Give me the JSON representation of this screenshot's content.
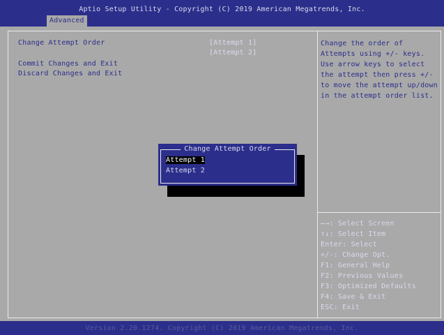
{
  "header": {
    "title": "Aptio Setup Utility - Copyright (C) 2019 American Megatrends, Inc.",
    "active_tab": "Advanced"
  },
  "main": {
    "items": [
      {
        "label": "Change Attempt Order",
        "values": [
          "[Attempt 1]",
          "[Attempt 2]"
        ]
      },
      {
        "label": "Commit Changes and Exit"
      },
      {
        "label": "Discard Changes and Exit"
      }
    ]
  },
  "help": {
    "lines": [
      "Change the order of",
      "Attempts using +/- keys.",
      "Use arrow keys to select",
      "the attempt then press +/-",
      "to move the attempt up/down",
      "in the attempt order list."
    ]
  },
  "keys": {
    "lines": [
      "←→: Select Screen",
      "↑↓: Select Item",
      "Enter: Select",
      "+/-: Change Opt.",
      "F1: General Help",
      "F2: Previous Values",
      "F3: Optimized Defaults",
      "F4: Save & Exit",
      "ESC: Exit"
    ]
  },
  "popup": {
    "title": "Change Attempt Order",
    "options": [
      "Attempt 1",
      "Attempt 2"
    ],
    "selected": "Attempt 1"
  },
  "footer": {
    "text": "Version 2.20.1274. Copyright (C) 2019 American Megatrends, Inc."
  },
  "colors": {
    "bios_blue": "#2b2e8a",
    "panel_gray": "#a9a9a9",
    "text_light": "#dadaf0"
  }
}
